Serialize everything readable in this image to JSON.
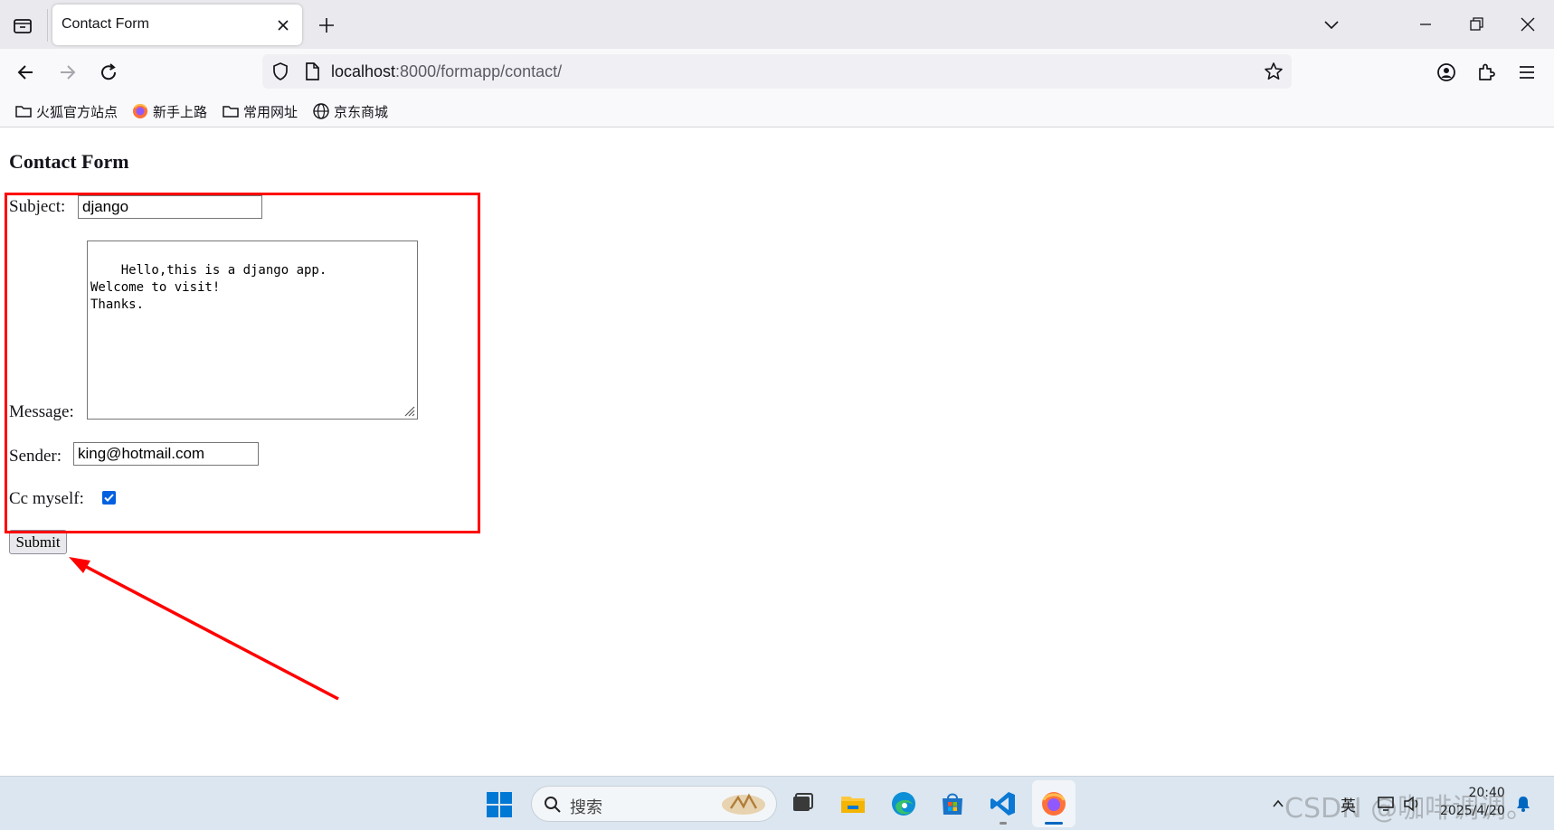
{
  "browser": {
    "tab": {
      "title": "Contact Form"
    },
    "url": {
      "host": "localhost",
      "rest": ":8000/formapp/contact/"
    },
    "bookmarks": [
      {
        "label": "火狐官方站点",
        "icon": "folder-icon"
      },
      {
        "label": "新手上路",
        "icon": "firefox-icon"
      },
      {
        "label": "常用网址",
        "icon": "folder-icon"
      },
      {
        "label": "京东商城",
        "icon": "globe-icon"
      }
    ]
  },
  "page": {
    "title": "Contact Form",
    "form": {
      "subject_label": "Subject:",
      "subject_value": "django",
      "message_label": "Message:",
      "message_value": "Hello,this is a django app.\nWelcome to visit!\nThanks.",
      "sender_label": "Sender:",
      "sender_value": "king@hotmail.com",
      "cc_label": "Cc myself:",
      "cc_checked": true,
      "submit_label": "Submit"
    }
  },
  "annotation": {
    "highlight_color": "#ff0000"
  },
  "taskbar": {
    "search_placeholder": "搜索",
    "ime_label": "英",
    "clock_time": "20:40",
    "clock_date": "2025/4/20",
    "watermark": "CSDN @咖啡调调。"
  },
  "colors": {
    "accent": "#0060df",
    "tabstrip": "#eaeaee",
    "taskbar": "#dbe6f0"
  }
}
